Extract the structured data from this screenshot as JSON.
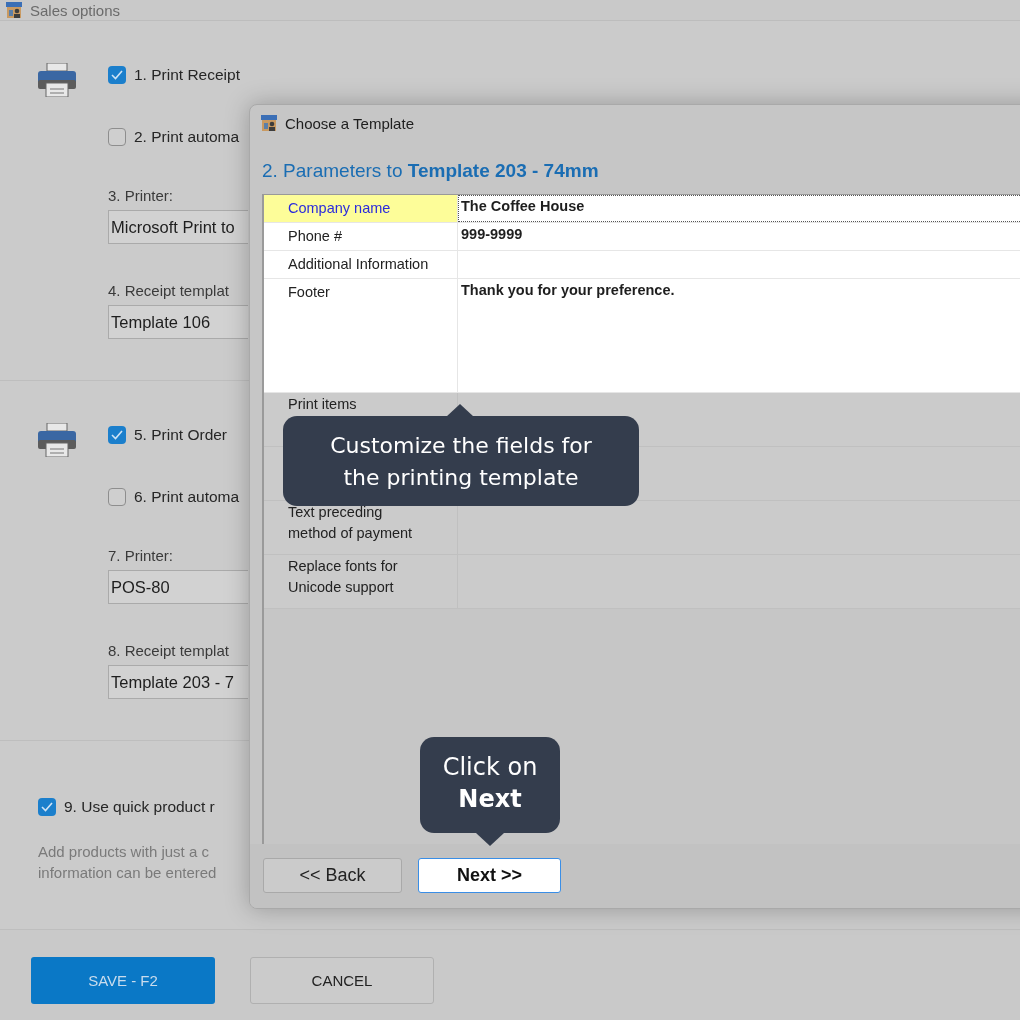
{
  "window": {
    "title": "Sales options"
  },
  "sections": [
    {
      "kind": "printer",
      "items": [
        {
          "kind": "checkbox",
          "label": "1. Print Receipt",
          "checked": true
        },
        {
          "kind": "checkbox",
          "label": "2. Print automa",
          "checked": false
        },
        {
          "kind": "field",
          "label": "3. Printer:",
          "value": "Microsoft Print to"
        },
        {
          "kind": "field",
          "label": "4. Receipt templat",
          "value": "Template 106"
        }
      ]
    },
    {
      "kind": "printer",
      "items": [
        {
          "kind": "checkbox",
          "label": "5. Print Order",
          "checked": true
        },
        {
          "kind": "checkbox",
          "label": "6. Print automa",
          "checked": false
        },
        {
          "kind": "field",
          "label": "7. Printer:",
          "value": "POS-80"
        },
        {
          "kind": "field",
          "label": "8. Receipt templat",
          "value": "Template 203 - 7"
        }
      ]
    },
    {
      "kind": "plain",
      "items": [
        {
          "kind": "checkbox",
          "label": "9. Use quick product r",
          "checked": true
        },
        {
          "kind": "note",
          "label": "Add products with just a c",
          "value": "information can be entered"
        }
      ]
    }
  ],
  "buttons": [
    {
      "label": "SAVE - F2",
      "primary": true
    },
    {
      "label": "CANCEL",
      "primary": false
    }
  ],
  "dialog": {
    "title": "Choose a Template",
    "heading": "2. Parameters to **Template 203 - 74mm**",
    "rows": [
      {
        "kind": "line",
        "label": "Company name",
        "value": "The Coffee House",
        "selected": true,
        "spotlight": true
      },
      {
        "kind": "line",
        "label": "Phone #",
        "value": "999-9999",
        "selected": false,
        "spotlight": true
      },
      {
        "kind": "line",
        "label": "Additional Information",
        "selected": false,
        "spotlight": true
      },
      {
        "kind": "memo",
        "label": "Footer",
        "value": "Thank you for your preference.",
        "selected": false,
        "spotlight": true
      },
      {
        "kind": "block",
        "label": "Print items",
        "selected": false,
        "spotlight": false
      },
      {
        "kind": "block",
        "selected": false,
        "spotlight": false
      },
      {
        "kind": "block",
        "label": "Text preceding method of payment",
        "selected": false,
        "spotlight": false
      },
      {
        "kind": "block",
        "label": "Replace fonts for Unicode support",
        "selected": false,
        "spotlight": false
      }
    ],
    "table_callout": {
      "text": "Customize the fields for the printing template",
      "kind": "up"
    },
    "buttons": [
      {
        "label": "<< Back",
        "focused": false
      },
      {
        "label": "Next >>",
        "focused": true
      }
    ],
    "buttons_callout": {
      "text": "Click on **Next**",
      "kind": "down"
    }
  }
}
